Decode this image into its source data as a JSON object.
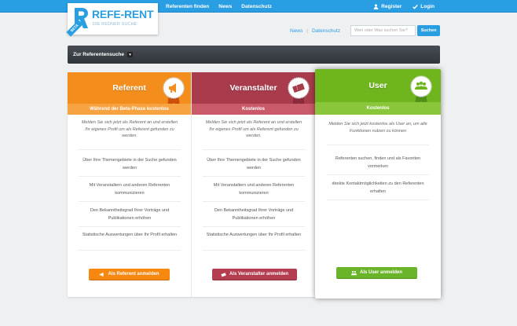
{
  "topnav": {
    "items": [
      "Referenten finden",
      "News",
      "Datenschutz"
    ],
    "register": "Register",
    "login": "Login"
  },
  "logo": {
    "name": "REFE-RENT",
    "tagline": "DIE REDNER SUCHE",
    "beta": "BETA"
  },
  "sublinks": {
    "news": "News",
    "sep": "|",
    "datenschutz": "Datenschutz"
  },
  "search": {
    "placeholder": "Wen oder Was suchen Sie?",
    "button": "Suchen"
  },
  "darkbar": {
    "dropdown_label": "Zur Referentensuche",
    "caret": "▾"
  },
  "columns": [
    {
      "title": "Referent",
      "price": "Während der Beta-Phase kostenlos",
      "description": "Melden Sie sich jetzt als Referent an und erstellen Ihr eigenes Profil um als Referent gefunden zu werden.",
      "features": [
        "Über Ihre Themengebiete in der Suche gefunden werden",
        "Mit Veranstaltern und anderen Referenten kommunizieren",
        "Den Bekanntheitsgrad Ihrer Vorträge und Publikationen erhöhen",
        "Statistische Auswertungen über Ihr Profil erhalten"
      ],
      "button": "Als Referent anmelden",
      "badge_icon": "megaphone-icon",
      "color": "#f38d1b"
    },
    {
      "title": "Veranstalter",
      "price": "Kostenlos",
      "description": "Melden Sie sich jetzt als Referent an und erstellen Ihr eigenes Profil um als Referent gefunden zu werden.",
      "features": [
        "Über Ihre Themengebiete in der Suche gefunden werden",
        "Mit Veranstaltern und anderen Referenten kommunizieren",
        "Den Bekanntheitsgrad Ihrer Vorträge und Publikationen erhöhen",
        "Statistische Auswertungen über Ihr Profil erhalten"
      ],
      "button": "Als Veranstalter anmelden",
      "badge_icon": "ticket-icon",
      "color": "#a83b4c"
    },
    {
      "title": "User",
      "price": "Kostenlos",
      "description": "Melden Sie sich jetzt kostenlos als User an, um alle Funktionen nutzen zu können",
      "features": [
        "Referenten suchen, finden und als Favoriten vormerken",
        "direkte Kontaktmöglichkeiten zu den Referenten erhalten"
      ],
      "button": "Als User anmelden",
      "badge_icon": "users-icon",
      "color": "#6fb51d"
    }
  ]
}
